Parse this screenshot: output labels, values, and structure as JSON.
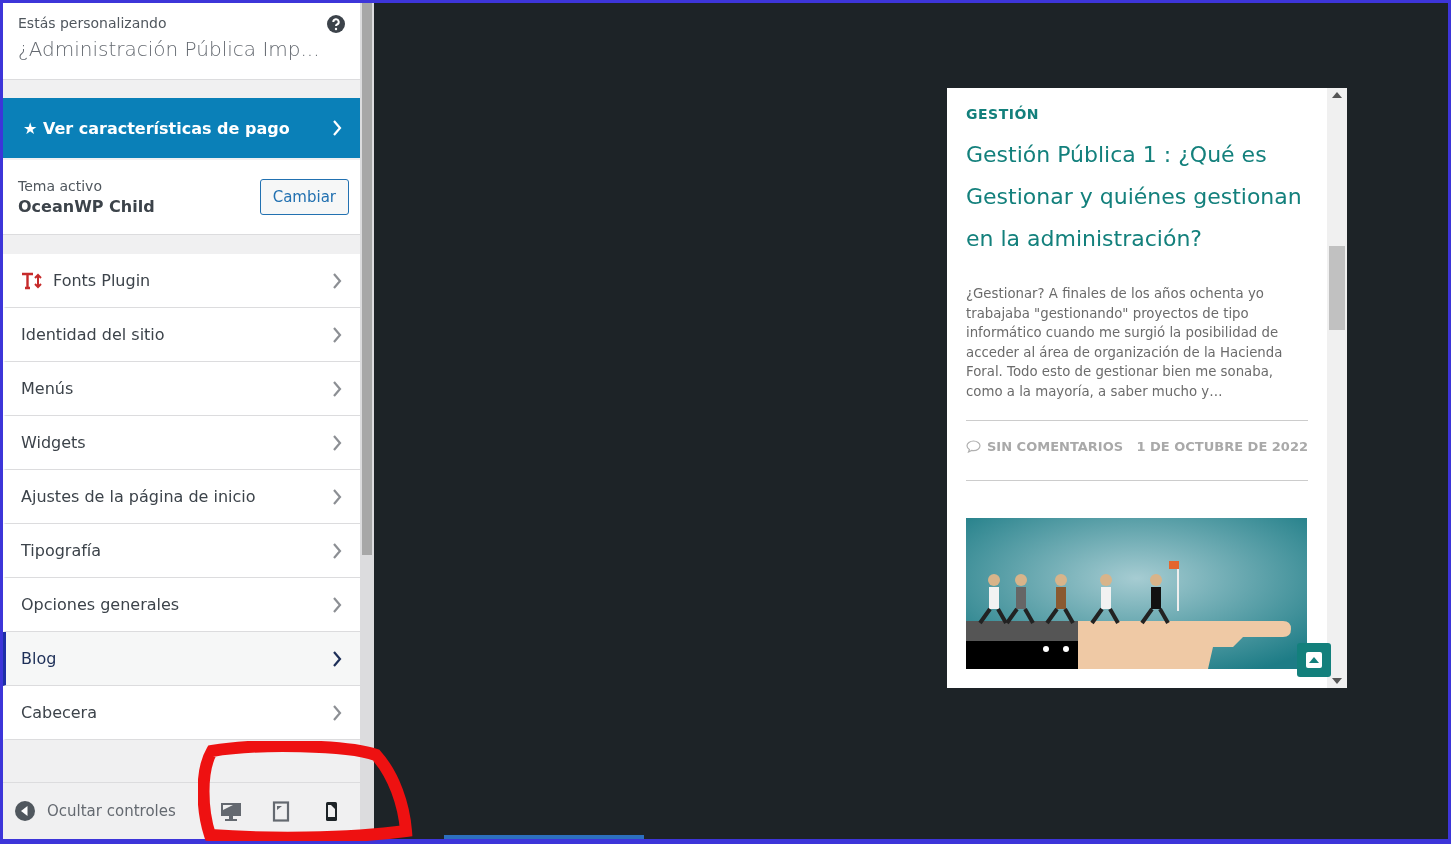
{
  "header": {
    "label": "Estás personalizando",
    "title": "¿Administración Pública Imp..."
  },
  "upgrade": {
    "label": "★ Ver características de pago"
  },
  "theme": {
    "label": "Tema activo",
    "name": "OceanWP Child",
    "button": "Cambiar"
  },
  "sections": [
    {
      "label": "Fonts Plugin",
      "kind": "plugin",
      "selected": false
    },
    {
      "label": "Identidad del sitio",
      "kind": "plain",
      "selected": false
    },
    {
      "label": "Menús",
      "kind": "plain",
      "selected": false
    },
    {
      "label": "Widgets",
      "kind": "plain",
      "selected": false
    },
    {
      "label": "Ajustes de la página de inicio",
      "kind": "plain",
      "selected": false
    },
    {
      "label": "Tipografía",
      "kind": "plain",
      "selected": false
    },
    {
      "label": "Opciones generales",
      "kind": "plain",
      "selected": false
    },
    {
      "label": "Blog",
      "kind": "plain",
      "selected": true
    },
    {
      "label": "Cabecera",
      "kind": "plain",
      "selected": false
    }
  ],
  "footer": {
    "hide_label": "Ocultar controles",
    "devices": [
      {
        "kind": "desktop",
        "selected": false
      },
      {
        "kind": "tablet",
        "selected": false
      },
      {
        "kind": "mobile",
        "selected": true
      }
    ]
  },
  "preview": {
    "category": "GESTIÓN",
    "post_title": "Gestión Pública 1 : ¿Qué es Gestionar y quiénes gestionan en la administración?",
    "excerpt": "¿Gestionar? A finales de los años ochenta yo trabajaba \"gestionando\" proyectos de tipo informático cuando me surgió la posibilidad de acceder al área de organización de la Hacienda Foral. Todo esto de gestionar bien me sonaba, como a la mayoría, a saber mucho y…",
    "comments": "SIN COMENTARIOS",
    "date": "1 DE OCTUBRE DE 2022"
  }
}
